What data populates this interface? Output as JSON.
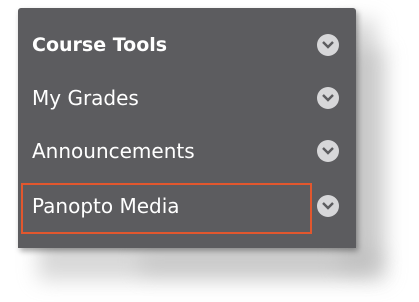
{
  "menu": {
    "items": [
      {
        "label": "Course Tools",
        "type": "header",
        "icon": "chevron-down-icon"
      },
      {
        "label": "My Grades",
        "type": "link",
        "icon": "chevron-down-icon"
      },
      {
        "label": "Announcements",
        "type": "link",
        "icon": "chevron-down-icon"
      },
      {
        "label": "Panopto Media",
        "type": "link",
        "icon": "chevron-down-icon",
        "highlighted": true
      }
    ]
  },
  "colors": {
    "panel": "#5c5c5f",
    "text": "#ffffff",
    "chevron_bg": "#d7d7d9",
    "highlight_border": "#e2572e"
  }
}
